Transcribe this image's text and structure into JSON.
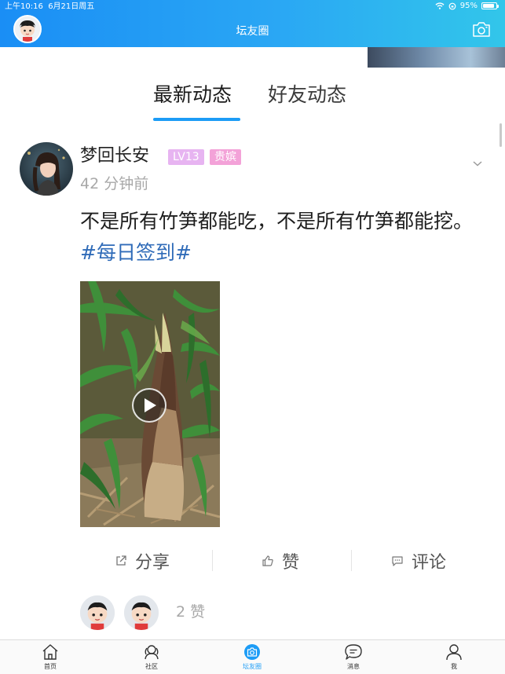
{
  "status_bar": {
    "time": "上午10:16",
    "date": "6月21日周五",
    "battery": "95%"
  },
  "nav": {
    "title": "坛友圈",
    "camera_icon": "camera-icon"
  },
  "tabs": [
    {
      "label": "最新动态",
      "active": true
    },
    {
      "label": "好友动态",
      "active": false
    }
  ],
  "post": {
    "username": "梦回长安",
    "level_badge": "LV13",
    "title_badge": "贵嫔",
    "time": "42 分钟前",
    "text": "不是所有竹笋都能吃，不是所有竹笋都能挖。",
    "hashtag": "#每日签到#",
    "media": {
      "type": "video",
      "icon": "play-icon"
    },
    "actions": {
      "share": "分享",
      "like": "赞",
      "comment": "评论"
    },
    "like_count": "2 赞"
  },
  "tabbar": {
    "items": [
      {
        "label": "首页",
        "icon": "home-icon"
      },
      {
        "label": "社区",
        "icon": "community-icon"
      },
      {
        "label": "坛友圈",
        "icon": "circle-camera-icon",
        "active": true
      },
      {
        "label": "消息",
        "icon": "message-icon"
      },
      {
        "label": "我",
        "icon": "profile-icon"
      }
    ]
  },
  "colors": {
    "header_start": "#1a8ef5",
    "header_end": "#32c6ea",
    "accent": "#1c9cf6",
    "hashtag": "#2f6bb8",
    "level_badge": "#e7b4f1",
    "title_badge": "#f3a2d8"
  }
}
